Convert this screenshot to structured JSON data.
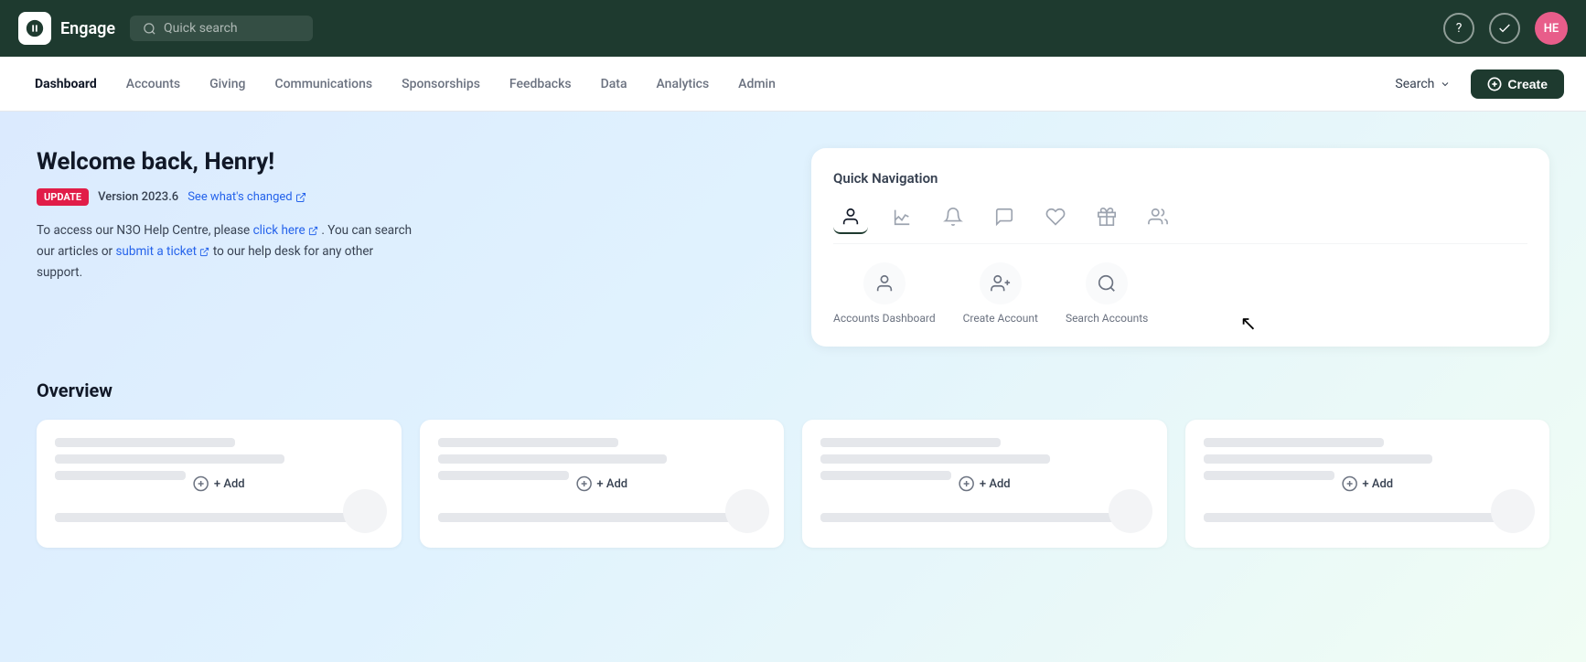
{
  "app": {
    "name": "Engage",
    "logo_alt": "Engage logo"
  },
  "topbar": {
    "search_placeholder": "Quick search",
    "help_label": "?",
    "check_label": "✓",
    "avatar_initials": "HE"
  },
  "nav": {
    "items": [
      {
        "label": "Dashboard",
        "active": true
      },
      {
        "label": "Accounts",
        "active": false
      },
      {
        "label": "Giving",
        "active": false
      },
      {
        "label": "Communications",
        "active": false
      },
      {
        "label": "Sponsorships",
        "active": false
      },
      {
        "label": "Feedbacks",
        "active": false
      },
      {
        "label": "Data",
        "active": false
      },
      {
        "label": "Analytics",
        "active": false
      },
      {
        "label": "Admin",
        "active": false
      }
    ],
    "search_label": "Search",
    "create_label": "Create"
  },
  "welcome": {
    "title": "Welcome back, Henry!",
    "badge": "UPDATE",
    "version": "Version 2023.6",
    "changes_link": "See what's changed",
    "help_text_1": "To access our N3O Help Centre, please",
    "click_here": "click here",
    "help_text_2": ". You can search our articles or",
    "submit_ticket": "submit a ticket",
    "help_text_3": "to our help desk for any other support."
  },
  "quick_navigation": {
    "title": "Quick Navigation",
    "icons": [
      {
        "name": "person-icon",
        "active": true
      },
      {
        "name": "chart-icon",
        "active": false
      },
      {
        "name": "bell-icon",
        "active": false
      },
      {
        "name": "chat-icon",
        "active": false
      },
      {
        "name": "heart-icon",
        "active": false
      },
      {
        "name": "gift-icon",
        "active": false
      },
      {
        "name": "group-icon",
        "active": false
      }
    ],
    "actions": [
      {
        "label": "Accounts Dashboard",
        "name": "accounts-dashboard-action"
      },
      {
        "label": "Create Account",
        "name": "create-account-action"
      },
      {
        "label": "Search Accounts",
        "name": "search-accounts-action"
      }
    ]
  },
  "overview": {
    "title": "Overview",
    "cards": [
      {
        "add_label": "+ Add"
      },
      {
        "add_label": "+ Add"
      },
      {
        "add_label": "+ Add"
      },
      {
        "add_label": "+ Add"
      }
    ]
  }
}
